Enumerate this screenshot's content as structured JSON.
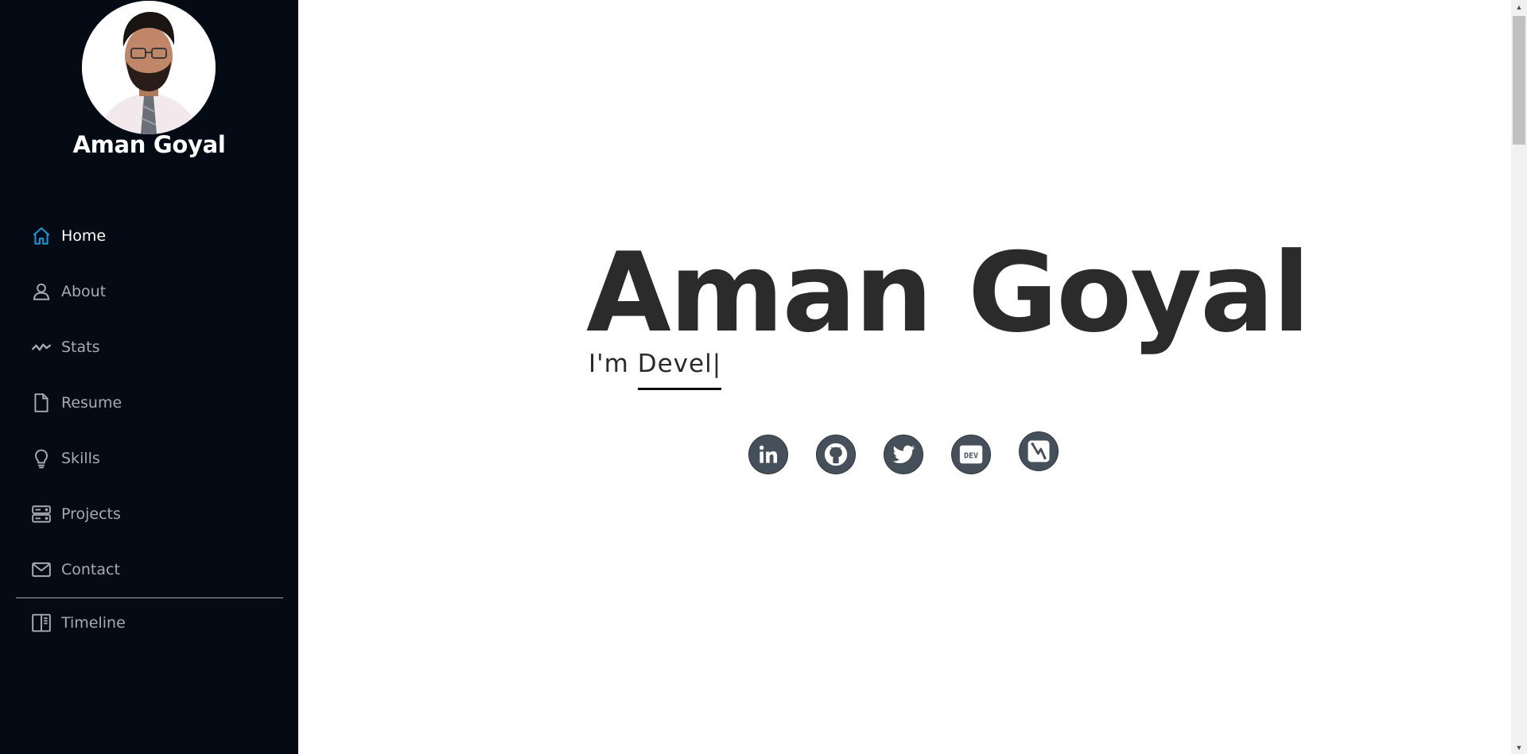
{
  "profile": {
    "name": "Aman Goyal"
  },
  "sidebar": {
    "items": [
      {
        "label": "Home",
        "icon": "home-icon",
        "active": true
      },
      {
        "label": "About",
        "icon": "person-icon",
        "active": false
      },
      {
        "label": "Stats",
        "icon": "activity-icon",
        "active": false
      },
      {
        "label": "Resume",
        "icon": "file-icon",
        "active": false
      },
      {
        "label": "Skills",
        "icon": "lightbulb-icon",
        "active": false
      },
      {
        "label": "Projects",
        "icon": "server-icon",
        "active": false
      },
      {
        "label": "Contact",
        "icon": "envelope-icon",
        "active": false
      }
    ],
    "timeline": {
      "label": "Timeline",
      "icon": "layout-icon"
    }
  },
  "hero": {
    "title": "Aman Goyal",
    "subtitle_prefix": "I'm ",
    "typed_text": "Devel",
    "caret": "|"
  },
  "socials": [
    {
      "name": "linkedin",
      "icon": "linkedin-icon"
    },
    {
      "name": "github",
      "icon": "github-icon"
    },
    {
      "name": "twitter",
      "icon": "twitter-icon"
    },
    {
      "name": "dev",
      "icon": "dev-icon",
      "text": "DEV"
    },
    {
      "name": "codeforces",
      "icon": "codeforces-icon"
    }
  ],
  "colors": {
    "sidebar_bg": "#040b14",
    "accent": "#149ddd",
    "nav_text": "#a8a9b4",
    "hero_text": "#2b2b2b",
    "social_bg": "#45505b"
  }
}
